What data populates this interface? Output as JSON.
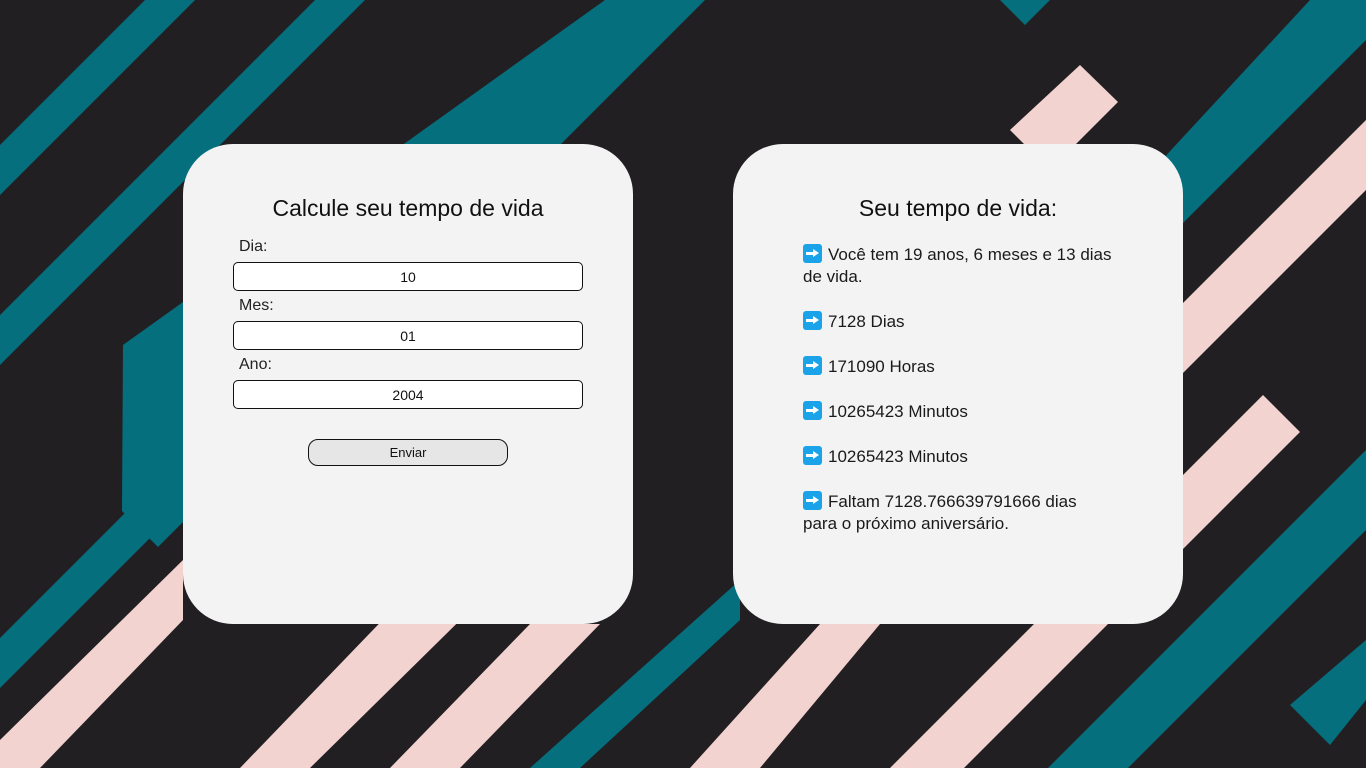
{
  "colors": {
    "background": "#211f22",
    "teal_stripe": "#066f7e",
    "pink_stripe": "#f3d3d0",
    "card": "#f3f3f3",
    "arrow_icon": "#1aa3e8"
  },
  "form_card": {
    "title": "Calcule seu tempo de vida",
    "day_label": "Dia:",
    "day_value": "10",
    "month_label": "Mes:",
    "month_value": "01",
    "year_label": "Ano:",
    "year_value": "2004",
    "submit_label": "Enviar"
  },
  "result_card": {
    "title": "Seu tempo de vida:",
    "items": [
      {
        "icon": "right-arrow-icon",
        "text": "Você tem 19 anos, 6 meses e 13 dias de vida."
      },
      {
        "icon": "right-arrow-icon",
        "text": "7128 Dias"
      },
      {
        "icon": "right-arrow-icon",
        "text": "171090 Horas"
      },
      {
        "icon": "right-arrow-icon",
        "text": "10265423 Minutos"
      },
      {
        "icon": "right-arrow-icon",
        "text": "10265423 Minutos"
      },
      {
        "icon": "right-arrow-icon",
        "text": "Faltam 7128.766639791666 dias para o próximo aniversário."
      }
    ]
  }
}
